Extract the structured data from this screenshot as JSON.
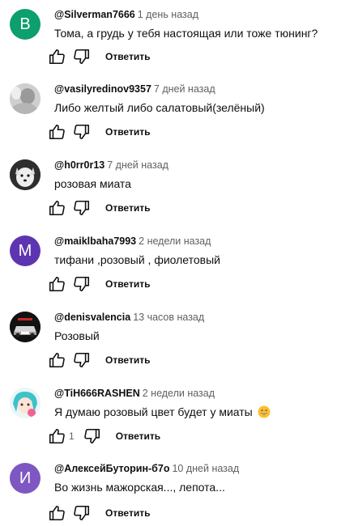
{
  "reply_label": "Ответить",
  "colors": {
    "avatar_green": "#0d9f6e",
    "avatar_purple": "#5e35b1",
    "avatar_violet": "#7e57c2"
  },
  "comments": [
    {
      "avatar_letter": "B",
      "handle": "@Silverman7666",
      "time": "1 день назад",
      "text": "Тома, а грудь у тебя настоящая или тоже тюнинг?"
    },
    {
      "avatar_icon": "photo-avatar-icon",
      "handle": "@vasilyredinov9357",
      "time": "7 дней назад",
      "text": "Либо желтый либо салатовый(зелёный)"
    },
    {
      "avatar_icon": "dog-avatar-icon",
      "handle": "@h0rr0r13",
      "time": "7 дней назад",
      "text": "розовая миата"
    },
    {
      "avatar_letter": "M",
      "handle": "@maiklbaha7993",
      "time": "2 недели назад",
      "text": "тифани ,розовый , фиолетовый"
    },
    {
      "avatar_icon": "car-avatar-icon",
      "handle": "@denisvalencia",
      "time": "13 часов назад",
      "text": "Розовый"
    },
    {
      "avatar_icon": "anime-avatar-icon",
      "handle": "@TiH666RASHEN",
      "time": "2 недели назад",
      "text": "Я думаю розовый цвет будет у миаты",
      "likes": "1"
    },
    {
      "avatar_letter": "И",
      "handle": "@АлексейБуторин-б7о",
      "time": "10 дней назад",
      "text": "Во жизнь мажорская..., лепота..."
    }
  ]
}
